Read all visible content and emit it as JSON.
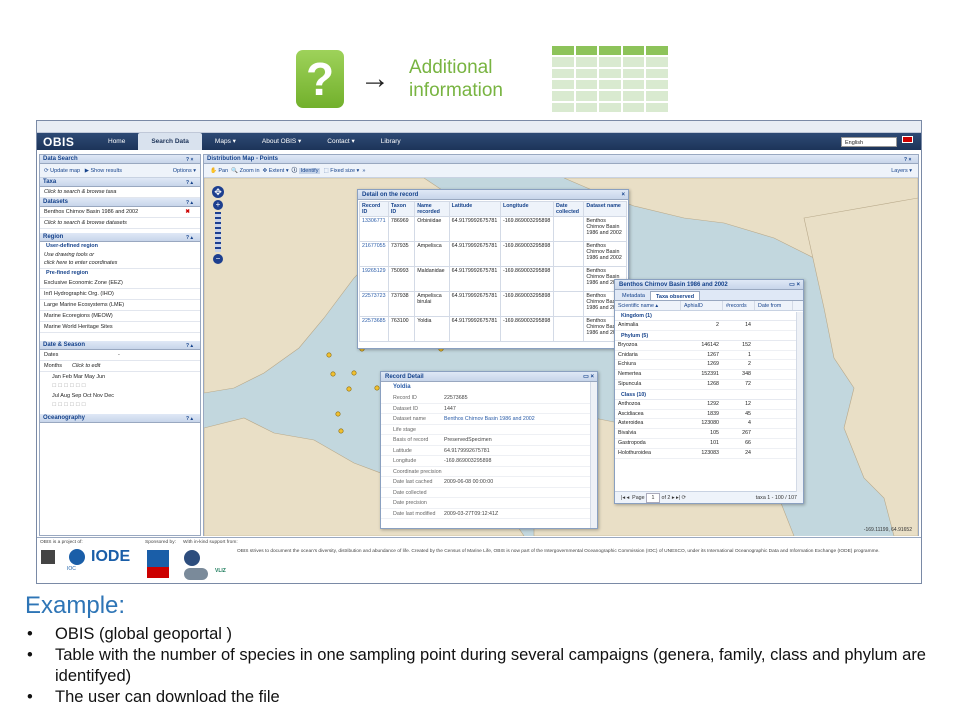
{
  "banner": {
    "question_mark": "?",
    "arrow": "→",
    "additional_line1": "Additional",
    "additional_line2": "information"
  },
  "app": {
    "logo": "OBIS",
    "nav": [
      "Home",
      "Search Data",
      "Maps ▾",
      "About OBIS ▾",
      "Contact ▾",
      "Library"
    ],
    "active_nav": "Search Data",
    "language": "English"
  },
  "data_search": {
    "title": "Data Search",
    "update_map": "Update map",
    "show_results": "Show results",
    "options": "Options ▾",
    "taxa_title": "Taxa",
    "taxa_hint": "Click to search & browse taxa",
    "datasets_title": "Datasets",
    "dataset_selected": "Benthos Chirnov Basin 1986 and 2002",
    "datasets_hint": "Click to search & browse datasets",
    "region_title": "Region",
    "user_defined": "User-defined region",
    "user_hint1": "Use drawing tools or",
    "user_hint2": "click here to enter coordinates",
    "predefined": "Pre-fined region",
    "regions": [
      "Exclusive Economic Zone (EEZ)",
      "Int'l Hydrographic Org. (IHO)",
      "Large Marine Ecosystems (LME)",
      "Marine Ecoregions (MEOW)",
      "Marine World Heritage Sites"
    ],
    "date_title": "Date & Season",
    "dates_label": "Dates",
    "dates_dash": "-",
    "months_label": "Months",
    "months_hint": "Click to edit",
    "months_row1": "Jan Feb Mar May Jun",
    "months_row2": "Jul Aug Sep Oct Nov Dec",
    "ocean_title": "Oceanography"
  },
  "map": {
    "title": "Distribution Map - Points",
    "toolbar": [
      "Pan",
      "Zoom in",
      "Extent ▾",
      "Identify",
      "Fixed size ▾",
      "»"
    ],
    "layers": "Layers ▾",
    "coords": "-169.11199, 64.91652"
  },
  "detail_window": {
    "title": "Detail on the record",
    "headers": [
      "Record ID",
      "Taxon ID",
      "Name recorded",
      "Latitude",
      "Longitude",
      "Date collected",
      "Dataset name"
    ],
    "rows": [
      [
        "13306771",
        "786969",
        "Orbiniidae",
        "64.9179992675781",
        "-169.869003295898",
        "",
        "Benthos Chirnov Basin 1986 and 2002"
      ],
      [
        "21677055",
        "737935",
        "Ampelisca",
        "64.9179992675781",
        "-169.869003295898",
        "",
        "Benthos Chirnov Basin 1986 and 2002"
      ],
      [
        "19265129",
        "750993",
        "Maldanidae",
        "64.9179992675781",
        "-169.869003295898",
        "",
        "Benthos Chirnov Basin 1986 and 2002"
      ],
      [
        "22573723",
        "737938",
        "Ampelisca birulai",
        "64.9179992675781",
        "-169.869003295898",
        "",
        "Benthos Chirnov Basin 1986 and 2002"
      ],
      [
        "22573685",
        "763100",
        "Yoldia",
        "64.9179992675781",
        "-169.869003295898",
        "",
        "Benthos Chirnov Basin 1986 and 2002"
      ]
    ]
  },
  "record_detail": {
    "title": "Record Detail",
    "name": "Yoldia",
    "fields": [
      [
        "Record ID",
        "22573685"
      ],
      [
        "Dataset ID",
        "1447"
      ],
      [
        "Dataset name",
        "Benthos Chirnov Basin 1986 and 2002"
      ],
      [
        "Life stage",
        ""
      ],
      [
        "Basis of record",
        "PreservedSpecimen"
      ],
      [
        "Latitude",
        "64.9179992675781"
      ],
      [
        "Longitude",
        "-169.869003295898"
      ],
      [
        "Coordinate precision",
        ""
      ],
      [
        "Date last cached",
        "2009-06-08 00:00:00"
      ],
      [
        "Date collected",
        ""
      ],
      [
        "Date precision",
        ""
      ],
      [
        "Date last modified",
        "2009-03-27T09:12:41Z"
      ]
    ]
  },
  "taxa_window": {
    "title": "Benthos Chirnov Basin 1986 and 2002",
    "tabs": [
      "Metadata",
      "Taxa observed"
    ],
    "columns": [
      "Scientific name ▴",
      "AphiaID",
      "#records",
      "Date from"
    ],
    "groups": [
      {
        "label": "Kingdom (1)",
        "rows": [
          [
            "Animalia",
            "2",
            "14"
          ]
        ]
      },
      {
        "label": "Phylum (5)",
        "rows": [
          [
            "Bryozoa",
            "146142",
            "152"
          ],
          [
            "Cnidaria",
            "1267",
            "1"
          ],
          [
            "Echiura",
            "1269",
            "2"
          ],
          [
            "Nemertea",
            "152391",
            "348"
          ],
          [
            "Sipuncula",
            "1268",
            "72"
          ]
        ]
      },
      {
        "label": "Class (10)",
        "rows": [
          [
            "Anthozoa",
            "1292",
            "12"
          ],
          [
            "Ascidiacea",
            "1839",
            "45"
          ],
          [
            "Asteroidea",
            "123080",
            "4"
          ],
          [
            "Bivalvia",
            "105",
            "267"
          ],
          [
            "Gastropoda",
            "101",
            "66"
          ],
          [
            "Holothuroidea",
            "123083",
            "24"
          ]
        ]
      }
    ],
    "pager_page": "Page",
    "pager_num": "1",
    "pager_of": "of 2",
    "pager_info": "taxa 1 - 100 / 107"
  },
  "footer": {
    "project_of": "OBIS is a project of:",
    "sponsored": "Sponsored by:",
    "inkind": "With in-kind support from:",
    "text": "OBIS strives to document the ocean's diversity, distribution and abundance of life. Created by the Census of Marine Life, OBIS is now part of the Intergovernmental Oceanographic Commission (IOC) of UNESCO, under its International Oceanographic Data and Information Exchange (IODE) programme.",
    "logos": [
      "IOC",
      "IODE",
      "VLIZ"
    ]
  },
  "example": {
    "heading": "Example:",
    "bullets": [
      "OBIS (global geoportal )",
      "Table with the number of species in one sampling point during several campaigns (genera, family, class and phylum are identifyed)",
      "The user can download the file"
    ]
  }
}
